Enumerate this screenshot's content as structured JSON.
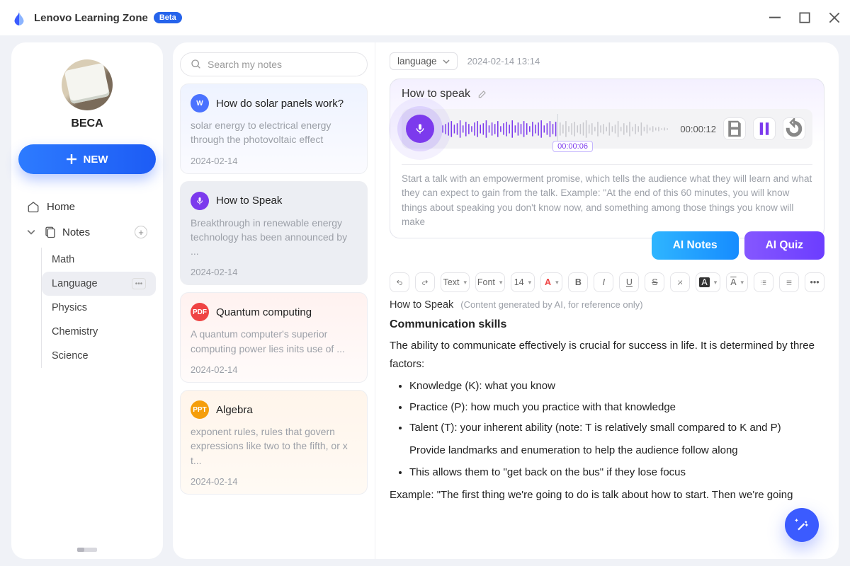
{
  "app": {
    "title": "Lenovo Learning Zone",
    "badge": "Beta"
  },
  "user": {
    "name": "BECA"
  },
  "new_button": {
    "label": "NEW"
  },
  "nav": {
    "home": "Home",
    "notes": "Notes",
    "subjects": [
      "Math",
      "Language",
      "Physics",
      "Chemistry",
      "Science"
    ],
    "active_subject": "Language"
  },
  "search": {
    "placeholder": "Search my notes"
  },
  "notes": [
    {
      "icon": "W",
      "title": "How do solar panels work?",
      "snippet": "solar energy to electrical energy through the photovoltaic effect",
      "date": "2024-02-14"
    },
    {
      "icon": "mic",
      "title": "How to Speak",
      "snippet": "Breakthrough in renewable energy technology has been announced by ...",
      "date": "2024-02-14"
    },
    {
      "icon": "PDF",
      "title": "Quantum computing",
      "snippet": "A quantum computer's superior computing power lies inits use of   ...",
      "date": "2024-02-14"
    },
    {
      "icon": "PPT",
      "title": "Algebra",
      "snippet": "exponent rules, rules that govern expressions like two to the fifth, or x t...",
      "date": "2024-02-14"
    }
  ],
  "detail": {
    "category": "language",
    "timestamp": "2024-02-14 13:14",
    "title": "How to speak",
    "time_current": "00:00:06",
    "time_total": "00:00:12",
    "transcript": "Start a talk with an empowerment promise, which tells the audience what they will learn and what they can expect to gain from the talk. Example: \"At the end of this 60 minutes, you will know things about speaking you don't know now, and something among those things you know will make"
  },
  "ai": {
    "notes": "AI Notes",
    "quiz": "AI Quiz"
  },
  "toolbar": {
    "text": "Text",
    "font": "Font",
    "size": "14"
  },
  "editor": {
    "title": "How to Speak",
    "disclaimer": "(Content generated by AI, for reference only)",
    "heading": "Communication skills",
    "intro": "The ability to communicate effectively is crucial for success in life. It is determined by three factors:",
    "bullets": [
      "Knowledge (K): what you know",
      "Practice (P): how much you practice with that knowledge",
      "Talent (T): your inherent ability (note: T is relatively small compared to K and P)",
      "This allows them to \"get back on the bus\" if they lose focus"
    ],
    "subline": "Provide landmarks and enumeration to help the audience follow along",
    "trailing": "Example: \"The first thing we're going to do is talk about how to start. Then we're going"
  }
}
